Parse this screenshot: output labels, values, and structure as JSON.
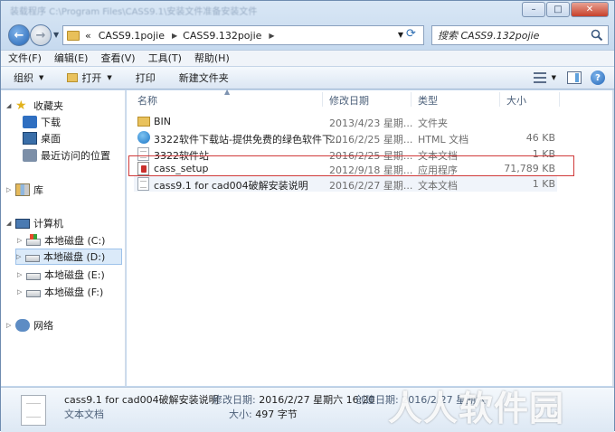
{
  "window": {
    "title_path": "装载程序 C:\\Program Files\\CASS9.1\\安装文件准备安装文件",
    "controls": {
      "minimize": "–",
      "maximize": "□",
      "close": "✕"
    }
  },
  "address": {
    "crumbs": [
      "CASS9.1pojie",
      "CASS9.132pojie"
    ],
    "overflow": "«"
  },
  "search": {
    "placeholder": "搜索 CASS9.132pojie"
  },
  "menu": [
    "文件(F)",
    "编辑(E)",
    "查看(V)",
    "工具(T)",
    "帮助(H)"
  ],
  "toolbar": {
    "organize": "组织",
    "open": "打开",
    "print": "打印",
    "new_folder": "新建文件夹"
  },
  "navtree": {
    "favorites": "收藏夹",
    "downloads": "下载",
    "desktop": "桌面",
    "recent": "最近访问的位置",
    "libraries": "库",
    "computer": "计算机",
    "drive_c": "本地磁盘 (C:)",
    "drive_d": "本地磁盘 (D:)",
    "drive_e": "本地磁盘 (E:)",
    "drive_f": "本地磁盘 (F:)",
    "network": "网络"
  },
  "columns": {
    "name": "名称",
    "modified": "修改日期",
    "type": "类型",
    "size": "大小"
  },
  "files": [
    {
      "name": "BIN",
      "date": "2013/4/23 星期...",
      "type": "文件夹",
      "size": "",
      "icon": "folder-icon"
    },
    {
      "name": "3322软件下载站-提供免费的绿色软件下...",
      "date": "2016/2/25 星期...",
      "type": "HTML 文档",
      "size": "46 KB",
      "icon": "html-icon"
    },
    {
      "name": "3322软件站",
      "date": "2016/2/25 星期...",
      "type": "文本文档",
      "size": "1 KB",
      "icon": "text-file-icon"
    },
    {
      "name": "cass_setup",
      "date": "2012/9/18 星期...",
      "type": "应用程序",
      "size": "71,789 KB",
      "icon": "setup-exe-icon"
    },
    {
      "name": "cass9.1 for cad004破解安装说明",
      "date": "2016/2/27 星期...",
      "type": "文本文档",
      "size": "1 KB",
      "icon": "text-file-icon"
    }
  ],
  "details": {
    "name": "cass9.1 for cad004破解安装说明",
    "type": "文本文档",
    "modified_label": "修改日期:",
    "modified_value": "2016/2/27 星期六 16:20",
    "created_label": "创建日期:",
    "created_value": "2016/2/27 星期六",
    "size_label": "大小:",
    "size_value": "497 字节"
  },
  "watermark": "人人软件园",
  "colors": {
    "highlight_border": "#d03a3a",
    "selection": "#dbeaf9"
  }
}
